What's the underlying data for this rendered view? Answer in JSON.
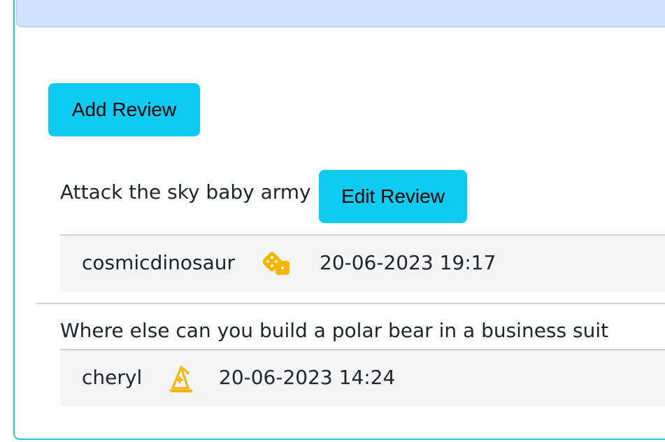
{
  "header": {},
  "actions": {
    "add_review_label": "Add Review",
    "edit_review_label": "Edit Review"
  },
  "reviews": [
    {
      "text": "Attack the sky baby army",
      "username": "cosmicdinosaur",
      "icon": "dice-icon",
      "timestamp": "20-06-2023 19:17"
    },
    {
      "text": "Where else can you build a polar bear in a business suit",
      "username": "cheryl",
      "icon": "wizard-hat-icon",
      "timestamp": "20-06-2023 14:24"
    }
  ],
  "colors": {
    "accent": "#0dcaf0",
    "header_bg": "#cfe2ff",
    "icon": "#f7b500",
    "card_border": "#2bc3d8"
  }
}
